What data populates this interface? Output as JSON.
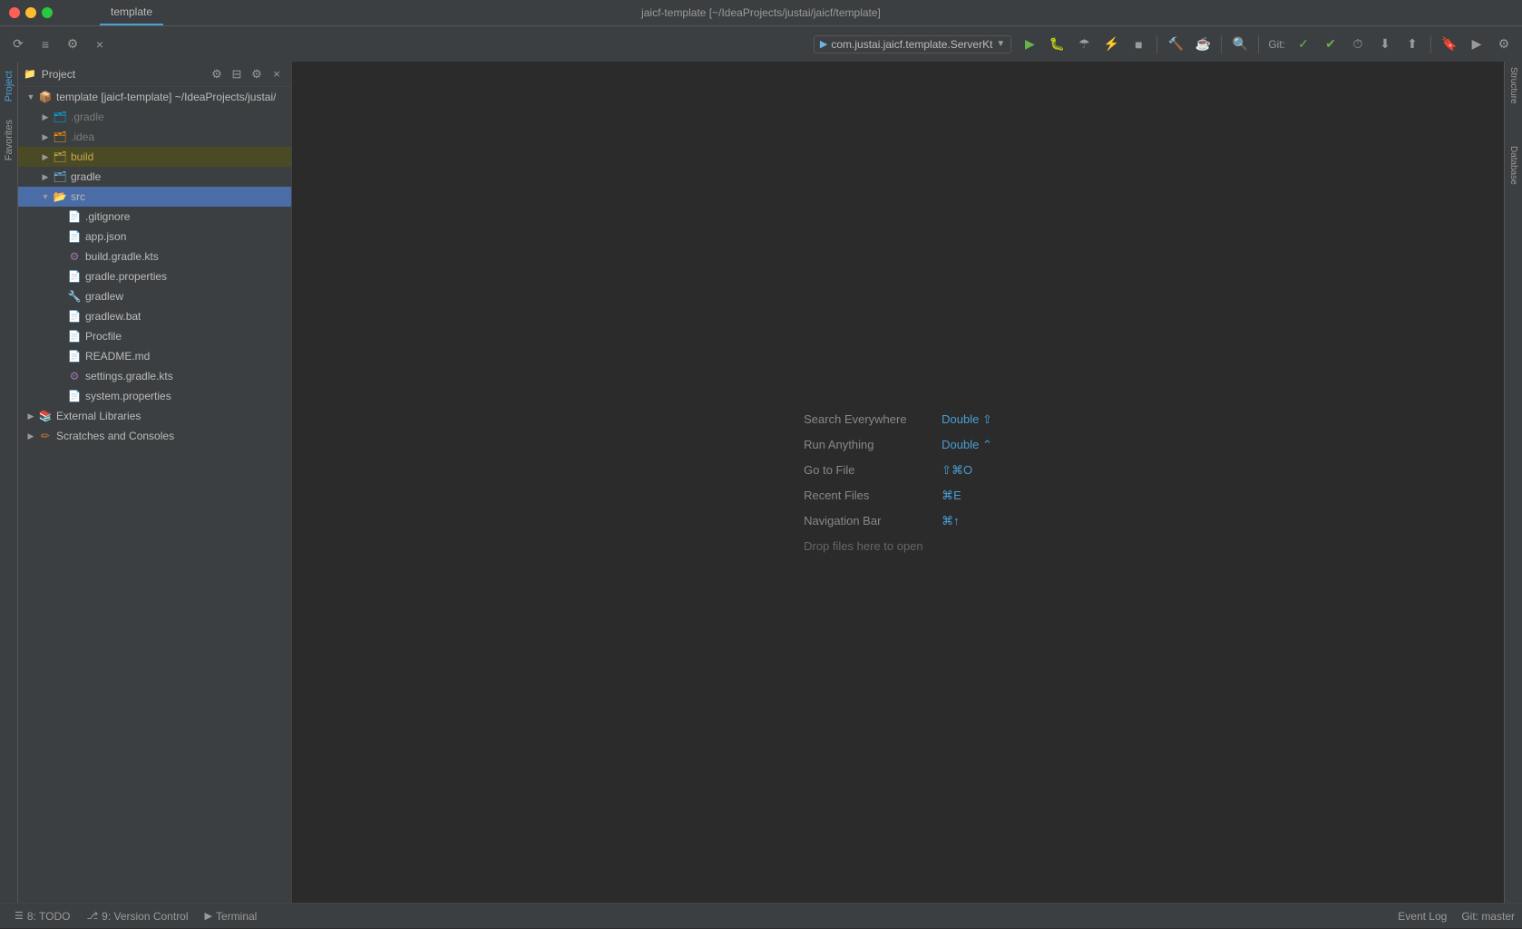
{
  "window": {
    "title": "jaicf-template [~/IdeaProjects/justai/jaicf/template]"
  },
  "tabs": [
    {
      "label": "template",
      "active": true
    }
  ],
  "toolbar": {
    "run_config": "com.justai.jaicf.template.ServerKt",
    "git_label": "Git:",
    "git_branch": "master"
  },
  "project_panel": {
    "title": "Project",
    "root": {
      "name": "template [jaicf-template]",
      "path": "~/IdeaProjects/justai/",
      "children": [
        {
          "name": ".gradle",
          "type": "folder-gradle",
          "expanded": false,
          "indent": 2
        },
        {
          "name": ".idea",
          "type": "folder-idea",
          "expanded": false,
          "indent": 2
        },
        {
          "name": "build",
          "type": "folder-build",
          "expanded": false,
          "indent": 2,
          "highlighted": true
        },
        {
          "name": "gradle",
          "type": "folder",
          "expanded": false,
          "indent": 2
        },
        {
          "name": "src",
          "type": "folder-src",
          "expanded": false,
          "indent": 2,
          "selected": true
        },
        {
          "name": ".gitignore",
          "type": "file-text",
          "indent": 3
        },
        {
          "name": "app.json",
          "type": "file-json",
          "indent": 3
        },
        {
          "name": "build.gradle.kts",
          "type": "file-kts",
          "indent": 3
        },
        {
          "name": "gradle.properties",
          "type": "file-props",
          "indent": 3
        },
        {
          "name": "gradlew",
          "type": "file-gradle",
          "indent": 3
        },
        {
          "name": "gradlew.bat",
          "type": "file-bat",
          "indent": 3
        },
        {
          "name": "Procfile",
          "type": "file-proc",
          "indent": 3
        },
        {
          "name": "README.md",
          "type": "file-md",
          "indent": 3
        },
        {
          "name": "settings.gradle.kts",
          "type": "file-kts",
          "indent": 3
        },
        {
          "name": "system.properties",
          "type": "file-props",
          "indent": 3
        }
      ]
    },
    "external_libraries": {
      "name": "External Libraries",
      "indent": 1
    },
    "scratches": {
      "name": "Scratches and Consoles",
      "indent": 1
    }
  },
  "editor": {
    "shortcuts": [
      {
        "label": "Search Everywhere",
        "key": "Double ⇧"
      },
      {
        "label": "Run Anything",
        "key": "Double ⌃"
      },
      {
        "label": "Go to File",
        "key": "⇧⌘O"
      },
      {
        "label": "Recent Files",
        "key": "⌘E"
      },
      {
        "label": "Navigation Bar",
        "key": "⌘↑"
      },
      {
        "label": "Drop files here to open",
        "key": ""
      }
    ]
  },
  "bottom_tabs": [
    {
      "num": "8",
      "label": "TODO",
      "icon": "☰"
    },
    {
      "num": "9",
      "label": "Version Control",
      "icon": "⎇"
    },
    {
      "num": "",
      "label": "Terminal",
      "icon": "▶"
    }
  ],
  "status_bar": {
    "right_label": "Event Log",
    "git_status": "Git: master"
  },
  "right_sidebar_tabs": [
    "Structure",
    "Database"
  ],
  "left_sidebar_tabs": [
    "Project",
    "Favorites"
  ]
}
